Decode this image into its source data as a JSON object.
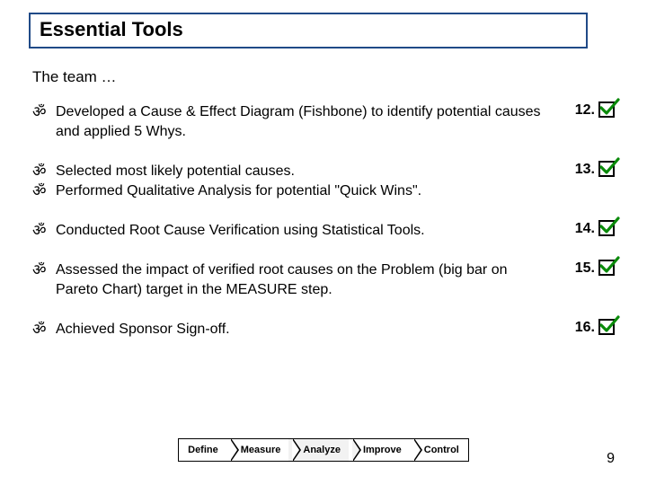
{
  "title": "Essential Tools",
  "intro": "The team …",
  "items": [
    {
      "lines": [
        "Developed a Cause & Effect Diagram (Fishbone) to identify potential causes and applied 5 Whys."
      ],
      "num": "12."
    },
    {
      "lines": [
        "Selected most likely potential causes.",
        "Performed Qualitative Analysis for potential \"Quick Wins\"."
      ],
      "num": "13."
    },
    {
      "lines": [
        "Conducted Root Cause Verification using Statistical Tools."
      ],
      "num": "14."
    },
    {
      "lines": [
        "Assessed the impact of verified root causes on the Problem (big bar on Pareto Chart) target in the MEASURE step."
      ],
      "num": "15."
    },
    {
      "lines": [
        "Achieved Sponsor Sign-off."
      ],
      "num": "16."
    }
  ],
  "phases": [
    "Define",
    "Measure",
    "Analyze",
    "Improve",
    "Control"
  ],
  "page_number": "9"
}
